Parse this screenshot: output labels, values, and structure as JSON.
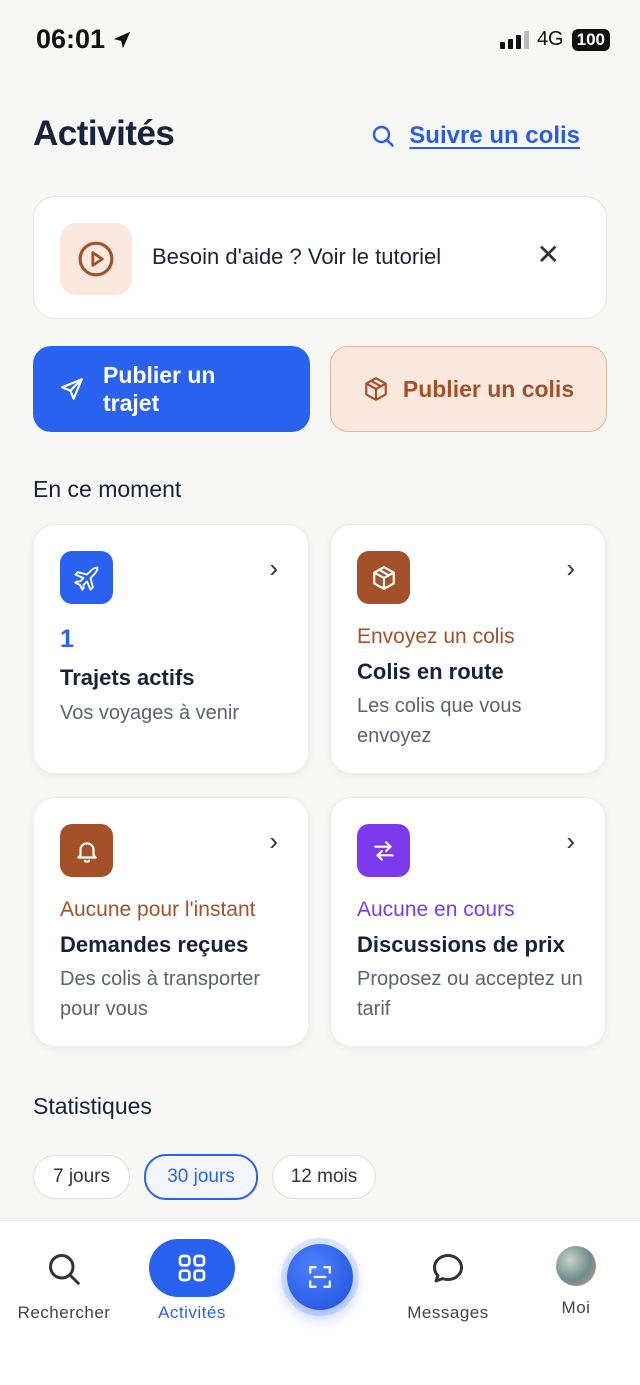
{
  "status_bar": {
    "time": "06:01",
    "network": "4G",
    "battery": "100"
  },
  "header": {
    "title": "Activités",
    "track_link": "Suivre un colis"
  },
  "banner": {
    "text": "Besoin d'aide ? Voir le tutoriel",
    "close": "✕"
  },
  "actions": {
    "publish_trip": "Publier un trajet",
    "publish_parcel": "Publier un colis"
  },
  "now": {
    "title": "En ce moment",
    "cards": [
      {
        "count": "1",
        "title": "Trajets actifs",
        "subtitle": "Vos voyages à venir",
        "color": "#2a62f0",
        "icon": "plane-icon"
      },
      {
        "status": "Envoyez un colis",
        "title": "Colis en route",
        "subtitle": "Les colis que vous envoyez",
        "color": "#a4512a",
        "icon": "box-icon"
      },
      {
        "status": "Aucune pour l'instant",
        "title": "Demandes reçues",
        "subtitle": "Des colis à transporter pour vous",
        "color": "#a4512a",
        "icon": "bell-icon"
      },
      {
        "status": "Aucune en cours",
        "title": "Discussions de prix",
        "subtitle": "Proposez ou acceptez un tarif",
        "color": "#7c3aed",
        "icon": "swap-icon"
      }
    ]
  },
  "stats": {
    "title": "Statistiques",
    "periods": [
      "7 jours",
      "30 jours",
      "12 mois"
    ],
    "selected": "30 jours"
  },
  "nav": {
    "items": [
      "Rechercher",
      "Activités",
      "Messages",
      "Moi"
    ],
    "active": "Activités"
  },
  "colors": {
    "primary": "#2a62f0",
    "brown": "#a4512a",
    "purple": "#7c3aed",
    "peach": "#fbe9df"
  }
}
